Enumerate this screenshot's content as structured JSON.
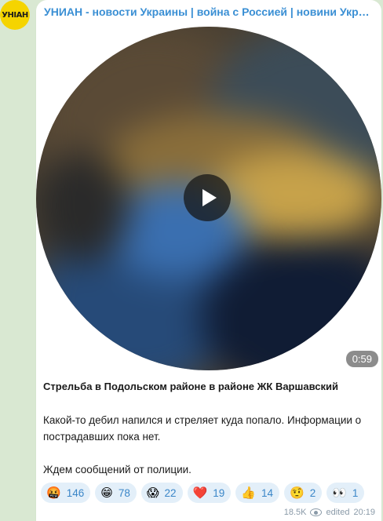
{
  "channel": {
    "avatar_text": "УНІАН",
    "name": "УНИАН - новости Украины | война с Россией | новини України | Україна"
  },
  "video": {
    "duration": "0:59"
  },
  "post": {
    "title": "Стрельба в Подольском районе в районе ЖК Варшавский",
    "paragraphs": [
      "Какой-то дебил напился и стреляет куда попало. Информации о пострадавших пока нет.",
      "Ждем сообщений от полиции."
    ]
  },
  "reactions": [
    {
      "emoji": "🤬",
      "count": "146"
    },
    {
      "emoji": "😁",
      "count": "78"
    },
    {
      "emoji": "😱",
      "count": "22"
    },
    {
      "emoji": "❤️",
      "count": "19"
    },
    {
      "emoji": "👍",
      "count": "14"
    },
    {
      "emoji": "🤨",
      "count": "2"
    },
    {
      "emoji": "👀",
      "count": "1"
    }
  ],
  "meta": {
    "views": "18.5K",
    "edited": "edited",
    "time": "20:19"
  },
  "colors": {
    "background": "#d9e8d2",
    "accent": "#3a8fd4",
    "reaction_bg": "#e3eff9",
    "avatar_yellow": "#f5d400"
  }
}
